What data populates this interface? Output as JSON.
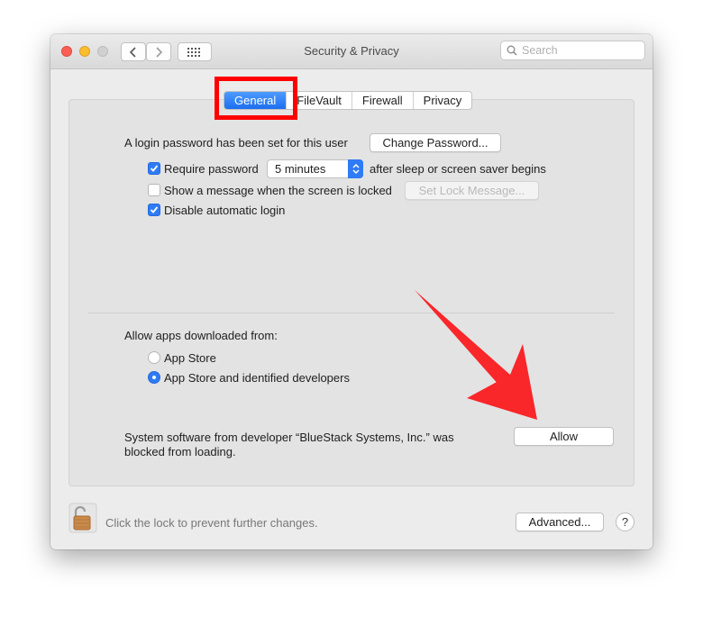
{
  "window": {
    "title": "Security & Privacy"
  },
  "search": {
    "placeholder": "Search"
  },
  "tabs": [
    {
      "label": "General",
      "active": true
    },
    {
      "label": "FileVault",
      "active": false
    },
    {
      "label": "Firewall",
      "active": false
    },
    {
      "label": "Privacy",
      "active": false
    }
  ],
  "general": {
    "login_text": "A login password has been set for this user",
    "change_password_label": "Change Password...",
    "require_password": {
      "label": "Require password",
      "checked": true
    },
    "require_delay": "5 minutes",
    "require_suffix": "after sleep or screen saver begins",
    "show_message": {
      "label": "Show a message when the screen is locked",
      "checked": false
    },
    "set_lock_message_label": "Set Lock Message...",
    "disable_auto_login": {
      "label": "Disable automatic login",
      "checked": true
    }
  },
  "downloads": {
    "heading": "Allow apps downloaded from:",
    "options": [
      {
        "label": "App Store",
        "selected": false
      },
      {
        "label": "App Store and identified developers",
        "selected": true
      }
    ]
  },
  "blocked": {
    "line1": "System software from developer “BlueStack Systems, Inc.” was",
    "line2": "blocked from loading.",
    "allow_label": "Allow"
  },
  "footer": {
    "lock_text": "Click the lock to prevent further changes.",
    "advanced_label": "Advanced...",
    "help_label": "?"
  },
  "colors": {
    "accent": "#2f7bf6",
    "highlight": "#fe0000",
    "arrow": "#f9262a"
  },
  "icons": [
    "back-chevron-icon",
    "forward-chevron-icon",
    "grid-icon",
    "search-icon",
    "checkmark-icon",
    "stepper-icon",
    "lock-icon",
    "red-arrow-annotation"
  ]
}
